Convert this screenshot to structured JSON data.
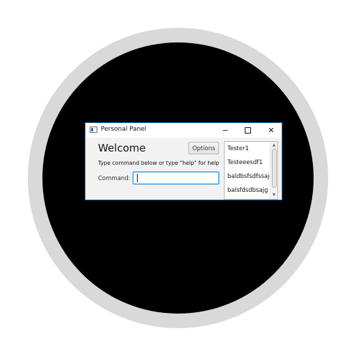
{
  "window": {
    "title": "Personal Panel",
    "controls": {
      "minimize": "−",
      "maximize": "□",
      "close": "✕"
    },
    "icon": "app-window-icon"
  },
  "main": {
    "heading": "Welcome",
    "options_label": "Options",
    "help_text": "Type command below or type \"help\" for help",
    "command_label": "Command:",
    "command_value": "",
    "command_placeholder": ""
  },
  "user_list": {
    "items": [
      "Tester1",
      "Testeeesdf1",
      "baldbsfsdfssajg",
      "balsfdsdbsajg"
    ]
  },
  "colors": {
    "window_border": "#1e88d8",
    "input_focus": "#2b93e0",
    "ring": "#d9d9d9",
    "disc": "#000000"
  }
}
